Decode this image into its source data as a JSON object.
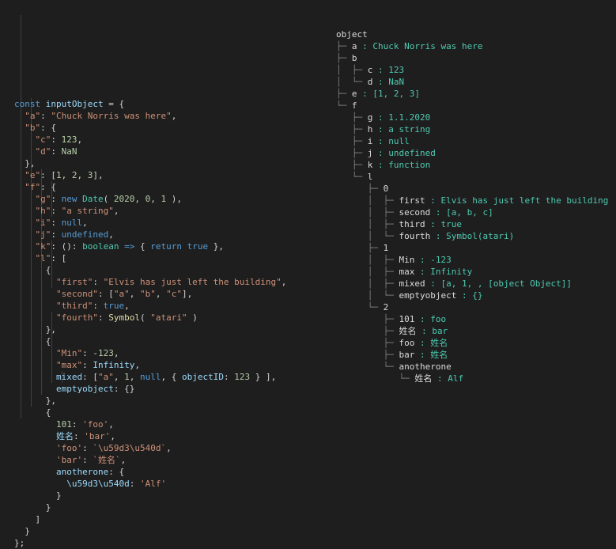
{
  "colors": {
    "background": "#1e1e1e",
    "key": "#9cdcfe",
    "string": "#ce9178",
    "number": "#b5cea8",
    "keyword": "#569cd6",
    "type": "#4ec9b0",
    "function": "#dcdcaa",
    "tree_value": "#4ec9b0",
    "tree_guide": "#7f7f7f"
  },
  "code_lines": [
    [
      [
        "kw",
        "const"
      ],
      [
        "pun",
        " "
      ],
      [
        "key",
        "inputObject"
      ],
      [
        "pun",
        " = {"
      ]
    ],
    [
      [
        "pun",
        "  "
      ],
      [
        "str",
        "\"a\""
      ],
      [
        "pun",
        ": "
      ],
      [
        "str",
        "\"Chuck Norris was here\""
      ],
      [
        "pun",
        ","
      ]
    ],
    [
      [
        "pun",
        "  "
      ],
      [
        "str",
        "\"b\""
      ],
      [
        "pun",
        ": {"
      ]
    ],
    [
      [
        "pun",
        "    "
      ],
      [
        "str",
        "\"c\""
      ],
      [
        "pun",
        ": "
      ],
      [
        "num",
        "123"
      ],
      [
        "pun",
        ","
      ]
    ],
    [
      [
        "pun",
        "    "
      ],
      [
        "str",
        "\"d\""
      ],
      [
        "pun",
        ": "
      ],
      [
        "num",
        "NaN"
      ]
    ],
    [
      [
        "pun",
        "  },"
      ]
    ],
    [
      [
        "pun",
        "  "
      ],
      [
        "str",
        "\"e\""
      ],
      [
        "pun",
        ": ["
      ],
      [
        "num",
        "1"
      ],
      [
        "pun",
        ", "
      ],
      [
        "num",
        "2"
      ],
      [
        "pun",
        ", "
      ],
      [
        "num",
        "3"
      ],
      [
        "pun",
        "],"
      ]
    ],
    [
      [
        "pun",
        "  "
      ],
      [
        "str",
        "\"f\""
      ],
      [
        "pun",
        ": {"
      ]
    ],
    [
      [
        "pun",
        "    "
      ],
      [
        "str",
        "\"g\""
      ],
      [
        "pun",
        ": "
      ],
      [
        "kw",
        "new"
      ],
      [
        "pun",
        " "
      ],
      [
        "typ",
        "Date"
      ],
      [
        "pun",
        "( "
      ],
      [
        "num",
        "2020"
      ],
      [
        "pun",
        ", "
      ],
      [
        "num",
        "0"
      ],
      [
        "pun",
        ", "
      ],
      [
        "num",
        "1"
      ],
      [
        "pun",
        " ),"
      ]
    ],
    [
      [
        "pun",
        "    "
      ],
      [
        "str",
        "\"h\""
      ],
      [
        "pun",
        ": "
      ],
      [
        "str",
        "\"a string\""
      ],
      [
        "pun",
        ","
      ]
    ],
    [
      [
        "pun",
        "    "
      ],
      [
        "str",
        "\"i\""
      ],
      [
        "pun",
        ": "
      ],
      [
        "kw",
        "null"
      ],
      [
        "pun",
        ","
      ]
    ],
    [
      [
        "pun",
        "    "
      ],
      [
        "str",
        "\"j\""
      ],
      [
        "pun",
        ": "
      ],
      [
        "kw",
        "undefined"
      ],
      [
        "pun",
        ","
      ]
    ],
    [
      [
        "pun",
        "    "
      ],
      [
        "str",
        "\"k\""
      ],
      [
        "pun",
        ": (): "
      ],
      [
        "typ",
        "boolean"
      ],
      [
        "pun",
        " "
      ],
      [
        "kw",
        "=>"
      ],
      [
        "pun",
        " { "
      ],
      [
        "kw",
        "return"
      ],
      [
        "pun",
        " "
      ],
      [
        "kw",
        "true"
      ],
      [
        "pun",
        " },"
      ]
    ],
    [
      [
        "pun",
        "    "
      ],
      [
        "str",
        "\"l\""
      ],
      [
        "pun",
        ": ["
      ]
    ],
    [
      [
        "pun",
        "      {"
      ]
    ],
    [
      [
        "pun",
        "        "
      ],
      [
        "str",
        "\"first\""
      ],
      [
        "pun",
        ": "
      ],
      [
        "str",
        "\"Elvis has just left the building\""
      ],
      [
        "pun",
        ","
      ]
    ],
    [
      [
        "pun",
        "        "
      ],
      [
        "str",
        "\"second\""
      ],
      [
        "pun",
        ": ["
      ],
      [
        "str",
        "\"a\""
      ],
      [
        "pun",
        ", "
      ],
      [
        "str",
        "\"b\""
      ],
      [
        "pun",
        ", "
      ],
      [
        "str",
        "\"c\""
      ],
      [
        "pun",
        "],"
      ]
    ],
    [
      [
        "pun",
        "        "
      ],
      [
        "str",
        "\"third\""
      ],
      [
        "pun",
        ": "
      ],
      [
        "kw",
        "true"
      ],
      [
        "pun",
        ","
      ]
    ],
    [
      [
        "pun",
        "        "
      ],
      [
        "str",
        "\"fourth\""
      ],
      [
        "pun",
        ": "
      ],
      [
        "fn",
        "Symbol"
      ],
      [
        "pun",
        "( "
      ],
      [
        "str",
        "\"atari\""
      ],
      [
        "pun",
        " )"
      ]
    ],
    [
      [
        "pun",
        "      },"
      ]
    ],
    [
      [
        "pun",
        "      {"
      ]
    ],
    [
      [
        "pun",
        "        "
      ],
      [
        "str",
        "\"Min\""
      ],
      [
        "pun",
        ": -"
      ],
      [
        "num",
        "123"
      ],
      [
        "pun",
        ","
      ]
    ],
    [
      [
        "pun",
        "        "
      ],
      [
        "str",
        "\"max\""
      ],
      [
        "pun",
        ": "
      ],
      [
        "key",
        "Infinity"
      ],
      [
        "pun",
        ","
      ]
    ],
    [
      [
        "pun",
        "        "
      ],
      [
        "key",
        "mixed"
      ],
      [
        "pun",
        ": ["
      ],
      [
        "str",
        "\"a\""
      ],
      [
        "pun",
        ", "
      ],
      [
        "num",
        "1"
      ],
      [
        "pun",
        ", "
      ],
      [
        "kw",
        "null"
      ],
      [
        "pun",
        ", { "
      ],
      [
        "key",
        "objectID"
      ],
      [
        "pun",
        ": "
      ],
      [
        "num",
        "123"
      ],
      [
        "pun",
        " } ],"
      ]
    ],
    [
      [
        "pun",
        "        "
      ],
      [
        "key",
        "emptyobject"
      ],
      [
        "pun",
        ": {}"
      ]
    ],
    [
      [
        "pun",
        "      },"
      ]
    ],
    [
      [
        "pun",
        "      {"
      ]
    ],
    [
      [
        "pun",
        "        "
      ],
      [
        "num",
        "101"
      ],
      [
        "pun",
        ": "
      ],
      [
        "str",
        "'foo'"
      ],
      [
        "pun",
        ","
      ]
    ],
    [
      [
        "pun",
        "        "
      ],
      [
        "key",
        "姓名"
      ],
      [
        "pun",
        ": "
      ],
      [
        "str",
        "'bar'"
      ],
      [
        "pun",
        ","
      ]
    ],
    [
      [
        "pun",
        "        "
      ],
      [
        "str",
        "'foo'"
      ],
      [
        "pun",
        ": "
      ],
      [
        "str",
        "`\\u59d3\\u540d`"
      ],
      [
        "pun",
        ","
      ]
    ],
    [
      [
        "pun",
        "        "
      ],
      [
        "str",
        "'bar'"
      ],
      [
        "pun",
        ": "
      ],
      [
        "str",
        "`姓名`"
      ],
      [
        "pun",
        ","
      ]
    ],
    [
      [
        "pun",
        "        "
      ],
      [
        "key",
        "anotherone"
      ],
      [
        "pun",
        ": {"
      ]
    ],
    [
      [
        "pun",
        "          "
      ],
      [
        "key",
        "\\u59d3\\u540d"
      ],
      [
        "pun",
        ": "
      ],
      [
        "str",
        "'Alf'"
      ]
    ],
    [
      [
        "pun",
        "        }"
      ]
    ],
    [
      [
        "pun",
        "      }"
      ]
    ],
    [
      [
        "pun",
        "    ]"
      ]
    ],
    [
      [
        "pun",
        "  }"
      ]
    ],
    [
      [
        "pun",
        "};"
      ]
    ]
  ],
  "tree_lines": [
    {
      "g": "",
      "k": "object",
      "v": ""
    },
    {
      "g": "├─ ",
      "k": "a",
      "v": "Chuck Norris was here"
    },
    {
      "g": "├─ ",
      "k": "b",
      "v": ""
    },
    {
      "g": "│  ├─ ",
      "k": "c",
      "v": "123"
    },
    {
      "g": "│  └─ ",
      "k": "d",
      "v": "NaN"
    },
    {
      "g": "├─ ",
      "k": "e",
      "v": "[1, 2, 3]"
    },
    {
      "g": "└─ ",
      "k": "f",
      "v": ""
    },
    {
      "g": "   ├─ ",
      "k": "g",
      "v": "1.1.2020"
    },
    {
      "g": "   ├─ ",
      "k": "h",
      "v": "a string"
    },
    {
      "g": "   ├─ ",
      "k": "i",
      "v": "null"
    },
    {
      "g": "   ├─ ",
      "k": "j",
      "v": "undefined"
    },
    {
      "g": "   ├─ ",
      "k": "k",
      "v": "function"
    },
    {
      "g": "   └─ ",
      "k": "l",
      "v": ""
    },
    {
      "g": "      ├─ ",
      "k": "0",
      "v": ""
    },
    {
      "g": "      │  ├─ ",
      "k": "first",
      "v": "Elvis has just left the building"
    },
    {
      "g": "      │  ├─ ",
      "k": "second",
      "v": "[a, b, c]"
    },
    {
      "g": "      │  ├─ ",
      "k": "third",
      "v": "true"
    },
    {
      "g": "      │  └─ ",
      "k": "fourth",
      "v": "Symbol(atari)"
    },
    {
      "g": "      ├─ ",
      "k": "1",
      "v": ""
    },
    {
      "g": "      │  ├─ ",
      "k": "Min",
      "v": "-123"
    },
    {
      "g": "      │  ├─ ",
      "k": "max",
      "v": "Infinity"
    },
    {
      "g": "      │  ├─ ",
      "k": "mixed",
      "v": "[a, 1, , [object Object]]"
    },
    {
      "g": "      │  └─ ",
      "k": "emptyobject",
      "v": "{}"
    },
    {
      "g": "      └─ ",
      "k": "2",
      "v": ""
    },
    {
      "g": "         ├─ ",
      "k": "101",
      "v": "foo"
    },
    {
      "g": "         ├─ ",
      "k": "姓名",
      "v": "bar"
    },
    {
      "g": "         ├─ ",
      "k": "foo",
      "v": "姓名"
    },
    {
      "g": "         ├─ ",
      "k": "bar",
      "v": "姓名"
    },
    {
      "g": "         └─ ",
      "k": "anotherone",
      "v": ""
    },
    {
      "g": "            └─ ",
      "k": "姓名",
      "v": "Alf"
    }
  ],
  "tree_separator": " : "
}
